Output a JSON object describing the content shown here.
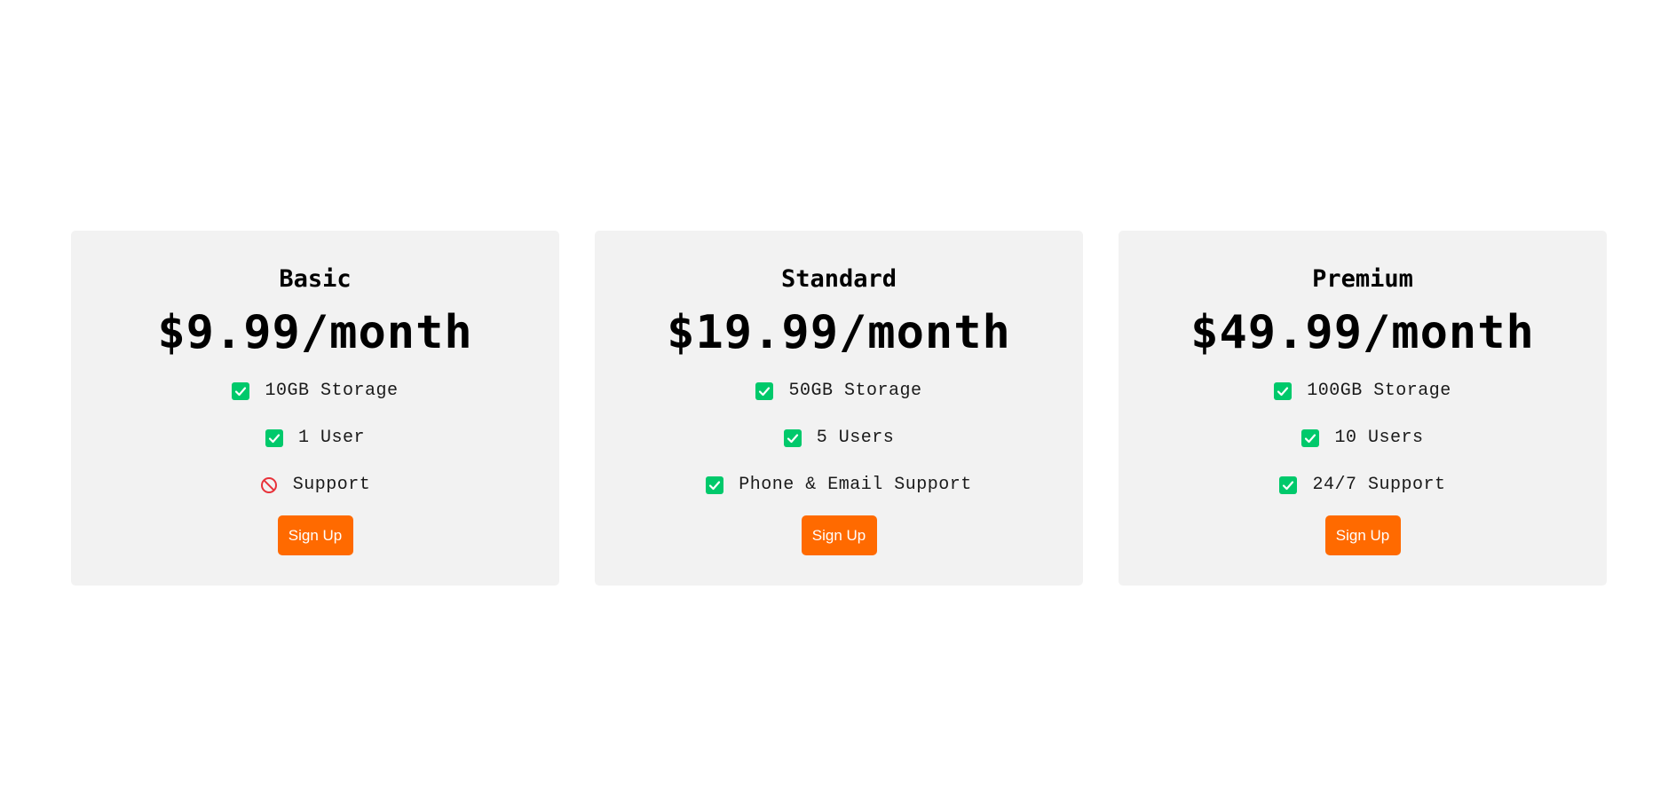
{
  "colors": {
    "card_bg": "#f2f2f2",
    "check": "#00c96b",
    "blocked": "#e8323a",
    "button": "#ff6a00"
  },
  "plans": [
    {
      "name": "Basic",
      "price": "$9.99/month",
      "features": [
        {
          "label": "10GB Storage",
          "icon": "check-icon",
          "included": true
        },
        {
          "label": "1 User",
          "icon": "check-icon",
          "included": true
        },
        {
          "label": "Support",
          "icon": "blocked-icon",
          "included": false
        }
      ],
      "button_label": "Sign Up"
    },
    {
      "name": "Standard",
      "price": "$19.99/month",
      "features": [
        {
          "label": "50GB Storage",
          "icon": "check-icon",
          "included": true
        },
        {
          "label": "5 Users",
          "icon": "check-icon",
          "included": true
        },
        {
          "label": "Phone & Email Support",
          "icon": "check-icon",
          "included": true
        }
      ],
      "button_label": "Sign Up"
    },
    {
      "name": "Premium",
      "price": "$49.99/month",
      "features": [
        {
          "label": "100GB Storage",
          "icon": "check-icon",
          "included": true
        },
        {
          "label": "10 Users",
          "icon": "check-icon",
          "included": true
        },
        {
          "label": "24/7 Support",
          "icon": "check-icon",
          "included": true
        }
      ],
      "button_label": "Sign Up"
    }
  ]
}
